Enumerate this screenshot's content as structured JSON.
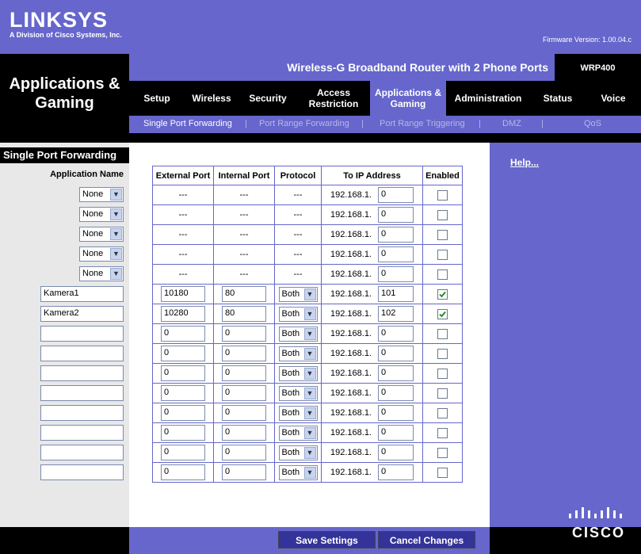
{
  "header": {
    "brand": "LINKSYS",
    "brand_sub": "A Division of Cisco Systems, Inc.",
    "firmware": "Firmware Version: 1.00.04.c",
    "product": "Wireless-G Broadband Router with 2 Phone Ports",
    "model": "WRP400",
    "section": "Applications & Gaming"
  },
  "tabs": [
    {
      "label": "Setup"
    },
    {
      "label": "Wireless"
    },
    {
      "label": "Security"
    },
    {
      "label": "Access Restriction"
    },
    {
      "label": "Applications & Gaming",
      "active": true
    },
    {
      "label": "Administration"
    },
    {
      "label": "Status"
    },
    {
      "label": "Voice"
    }
  ],
  "subtabs": [
    {
      "label": "Single Port Forwarding",
      "active": true
    },
    {
      "label": "Port Range Forwarding"
    },
    {
      "label": "Port Range Triggering"
    },
    {
      "label": "DMZ"
    },
    {
      "label": "QoS"
    }
  ],
  "left": {
    "title": "Single Port Forwarding",
    "app_name_label": "Application Name"
  },
  "table": {
    "headers": [
      "External Port",
      "Internal Port",
      "Protocol",
      "To IP Address",
      "Enabled"
    ],
    "ip_prefix": "192.168.1.",
    "rows": [
      {
        "app": "None",
        "app_type": "select",
        "ext": "---",
        "int": "---",
        "proto": "---",
        "ip": "0",
        "enabled": false
      },
      {
        "app": "None",
        "app_type": "select",
        "ext": "---",
        "int": "---",
        "proto": "---",
        "ip": "0",
        "enabled": false
      },
      {
        "app": "None",
        "app_type": "select",
        "ext": "---",
        "int": "---",
        "proto": "---",
        "ip": "0",
        "enabled": false
      },
      {
        "app": "None",
        "app_type": "select",
        "ext": "---",
        "int": "---",
        "proto": "---",
        "ip": "0",
        "enabled": false
      },
      {
        "app": "None",
        "app_type": "select",
        "ext": "---",
        "int": "---",
        "proto": "---",
        "ip": "0",
        "enabled": false
      },
      {
        "app": "Kamera1",
        "app_type": "input",
        "ext": "10180",
        "int": "80",
        "proto": "Both",
        "ip": "101",
        "enabled": true
      },
      {
        "app": "Kamera2",
        "app_type": "input",
        "ext": "10280",
        "int": "80",
        "proto": "Both",
        "ip": "102",
        "enabled": true
      },
      {
        "app": "",
        "app_type": "input",
        "ext": "0",
        "int": "0",
        "proto": "Both",
        "ip": "0",
        "enabled": false
      },
      {
        "app": "",
        "app_type": "input",
        "ext": "0",
        "int": "0",
        "proto": "Both",
        "ip": "0",
        "enabled": false
      },
      {
        "app": "",
        "app_type": "input",
        "ext": "0",
        "int": "0",
        "proto": "Both",
        "ip": "0",
        "enabled": false
      },
      {
        "app": "",
        "app_type": "input",
        "ext": "0",
        "int": "0",
        "proto": "Both",
        "ip": "0",
        "enabled": false
      },
      {
        "app": "",
        "app_type": "input",
        "ext": "0",
        "int": "0",
        "proto": "Both",
        "ip": "0",
        "enabled": false
      },
      {
        "app": "",
        "app_type": "input",
        "ext": "0",
        "int": "0",
        "proto": "Both",
        "ip": "0",
        "enabled": false
      },
      {
        "app": "",
        "app_type": "input",
        "ext": "0",
        "int": "0",
        "proto": "Both",
        "ip": "0",
        "enabled": false
      },
      {
        "app": "",
        "app_type": "input",
        "ext": "0",
        "int": "0",
        "proto": "Both",
        "ip": "0",
        "enabled": false
      }
    ]
  },
  "help": "Help...",
  "footer_logo": "CISCO",
  "buttons": {
    "save": "Save Settings",
    "cancel": "Cancel Changes"
  },
  "colors": {
    "accent": "#6666cc",
    "button": "#333399",
    "check": "#1a8a1a"
  }
}
